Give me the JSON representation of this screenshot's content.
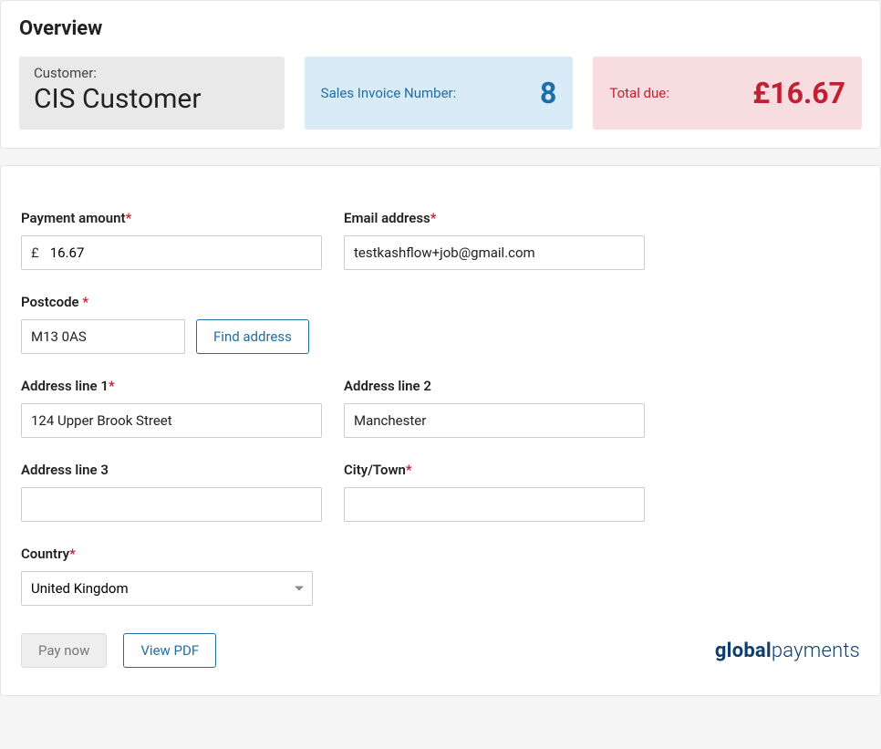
{
  "overview": {
    "title": "Overview",
    "customer": {
      "label": "Customer:",
      "value": "CIS Customer"
    },
    "invoice": {
      "label": "Sales Invoice Number:",
      "value": "8"
    },
    "due": {
      "label": "Total due:",
      "value": "£16.67"
    }
  },
  "form": {
    "payment_amount": {
      "label": "Payment amount",
      "currency": "£",
      "value": "16.67"
    },
    "email": {
      "label": "Email address",
      "value": "testkashflow+job@gmail.com"
    },
    "postcode": {
      "label": "Postcode ",
      "value": "M13 0AS",
      "find_button": "Find address"
    },
    "address1": {
      "label": "Address line 1",
      "value": "124 Upper Brook Street"
    },
    "address2": {
      "label": "Address line 2",
      "value": "Manchester"
    },
    "address3": {
      "label": "Address line 3",
      "value": ""
    },
    "city": {
      "label": "City/Town",
      "value": ""
    },
    "country": {
      "label": "Country",
      "value": "United Kingdom"
    }
  },
  "buttons": {
    "pay_now": "Pay now",
    "view_pdf": "View PDF"
  },
  "brand": {
    "part1": "global",
    "part2": "payments"
  }
}
